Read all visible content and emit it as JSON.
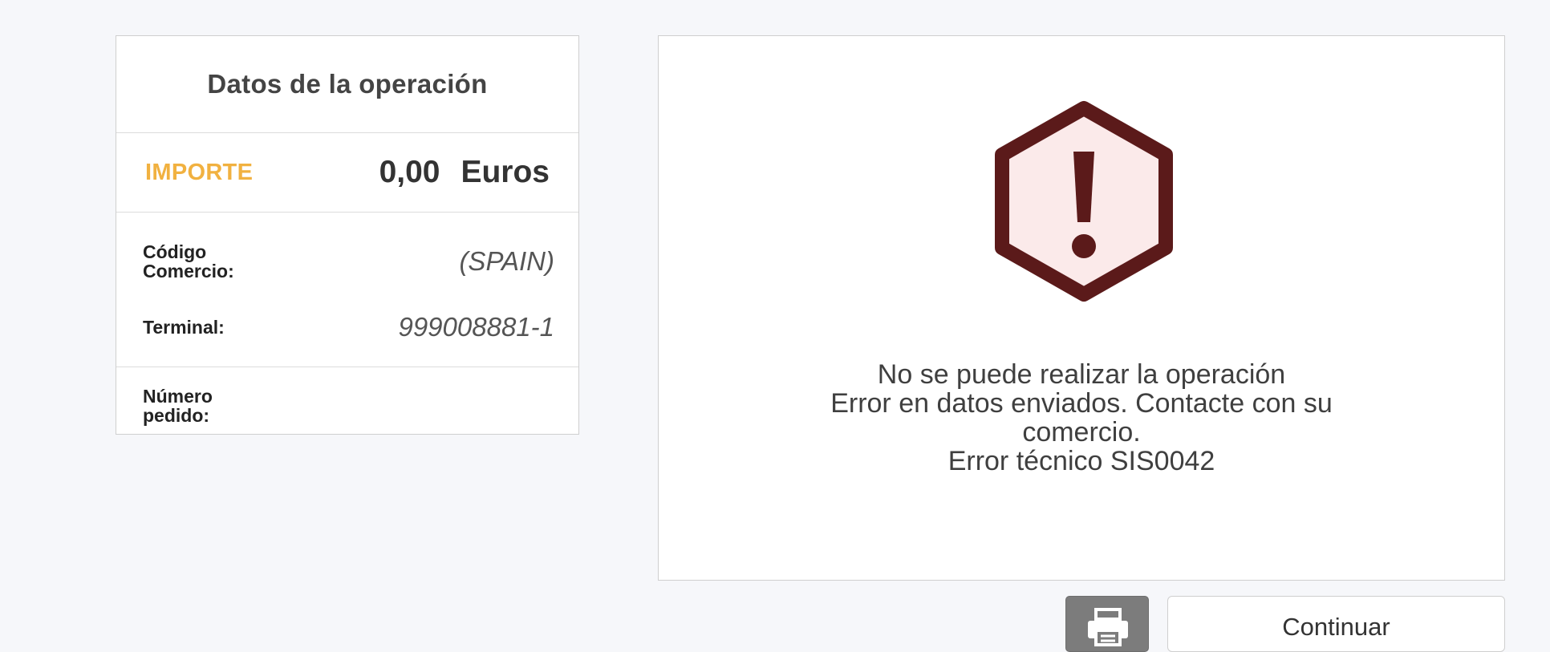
{
  "operation": {
    "title": "Datos de la operación",
    "amount_label": "IMPORTE",
    "amount_value": "0,00",
    "amount_currency": "Euros",
    "commerce_label": "Código Comercio:",
    "commerce_value": "(SPAIN)",
    "terminal_label": "Terminal:",
    "terminal_value": "999008881-1",
    "order_label": "Número pedido:",
    "order_value": ""
  },
  "error": {
    "icon": "warning-hexagon-icon",
    "line1": "No se puede realizar la operación",
    "line2": "Error en datos enviados. Contacte con su comercio.",
    "line3": "Error técnico SIS0042",
    "colors": {
      "icon_stroke": "#5b1a1a",
      "icon_fill": "#fbeaea"
    }
  },
  "actions": {
    "print_icon": "printer-icon",
    "continue_label": "Continuar"
  },
  "colors": {
    "accent": "#f1b140",
    "background": "#f6f7fa",
    "print_button": "#7c7c7c"
  }
}
